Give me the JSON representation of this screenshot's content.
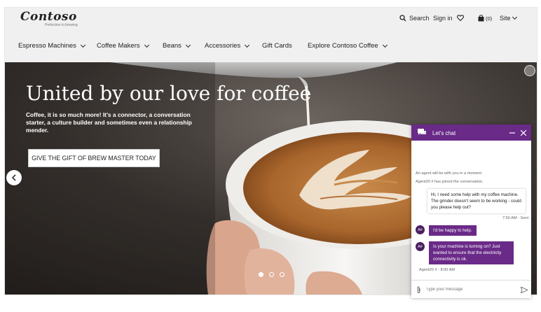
{
  "header": {
    "logo": "Contoso",
    "tagline": "Perfection in brewing",
    "search_label": "Search",
    "signin_label": "Sign in",
    "cart_count": "(0)",
    "site_label": "Site"
  },
  "nav": {
    "items": [
      {
        "label": "Espresso Machines"
      },
      {
        "label": "Coffee Makers"
      },
      {
        "label": "Beans"
      },
      {
        "label": "Accessories"
      },
      {
        "label": "Gift Cards"
      },
      {
        "label": "Explore Contoso Coffee"
      }
    ]
  },
  "hero": {
    "title": "United by our love for coffee",
    "body": "Coffee, it is so much more! It's a connector, a conversation starter, a culture builder and sometimes even a relationship mender.",
    "cta": "GIVE THE GIFT OF BREW MASTER TODAY",
    "slides_total": 3,
    "slide_active": 1
  },
  "chat": {
    "title": "Let's chat",
    "system_messages": [
      "An agent will be with you in a moment.",
      "Agent20 # has joined the conversation."
    ],
    "user_message": "Hi, I need some help with my coffee machine. The grinder doesn't seem to be working - could you please help out?",
    "user_meta": "7:50 AM - Sent",
    "agent_initials": "A#",
    "agent_messages": [
      "I'd be happy to help.",
      "Is your machine is turning on? Just wanted to ensure that the electricity connectivity is ok."
    ],
    "agent_meta": "Agent20 # - 8:00 AM",
    "input_placeholder": "Type your message"
  },
  "colors": {
    "chat_accent": "#6a2a88",
    "nav_bg": "#f1f0f0"
  }
}
